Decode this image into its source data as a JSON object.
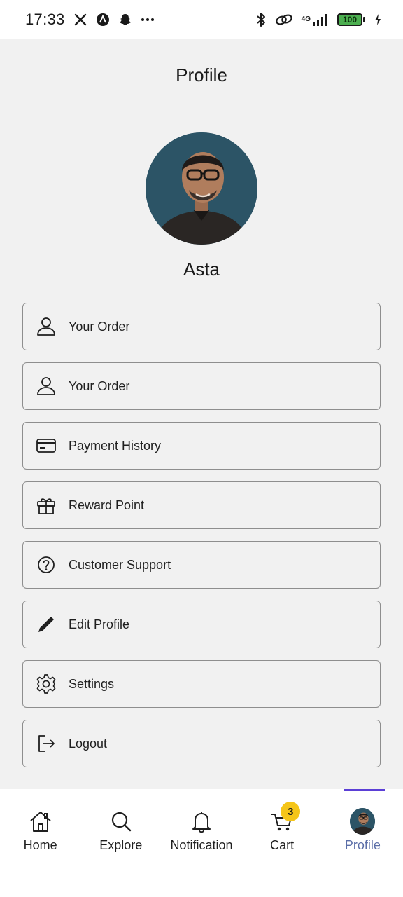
{
  "status_bar": {
    "time": "17:33",
    "network_label": "4G",
    "battery_level": "100",
    "icons": [
      "x-icon",
      "app-icon",
      "snapchat-icon",
      "more-icon",
      "bluetooth-icon",
      "link-icon",
      "signal-icon",
      "battery-icon",
      "charging-icon"
    ]
  },
  "header": {
    "title": "Profile"
  },
  "profile": {
    "name": "Asta"
  },
  "menu": {
    "items": [
      {
        "label": "Your Order",
        "icon": "person-icon"
      },
      {
        "label": "Your Order",
        "icon": "person-icon"
      },
      {
        "label": "Payment History",
        "icon": "card-icon"
      },
      {
        "label": "Reward Point",
        "icon": "gift-icon"
      },
      {
        "label": "Customer Support",
        "icon": "help-circle-icon"
      },
      {
        "label": "Edit Profile",
        "icon": "pencil-icon"
      },
      {
        "label": "Settings",
        "icon": "gear-icon"
      },
      {
        "label": "Logout",
        "icon": "logout-icon"
      }
    ]
  },
  "bottom_nav": {
    "items": [
      {
        "label": "Home",
        "icon": "home-icon"
      },
      {
        "label": "Explore",
        "icon": "search-icon"
      },
      {
        "label": "Notification",
        "icon": "bell-icon"
      },
      {
        "label": "Cart",
        "icon": "cart-icon"
      },
      {
        "label": "Profile",
        "icon": "avatar"
      }
    ],
    "active": "Profile",
    "cart_count": "3"
  },
  "colors": {
    "background": "#f1f1f1",
    "active_nav": "#5b6ea8",
    "indicator": "#5b3fd6",
    "badge": "#f5c518",
    "battery": "#4caf50"
  }
}
